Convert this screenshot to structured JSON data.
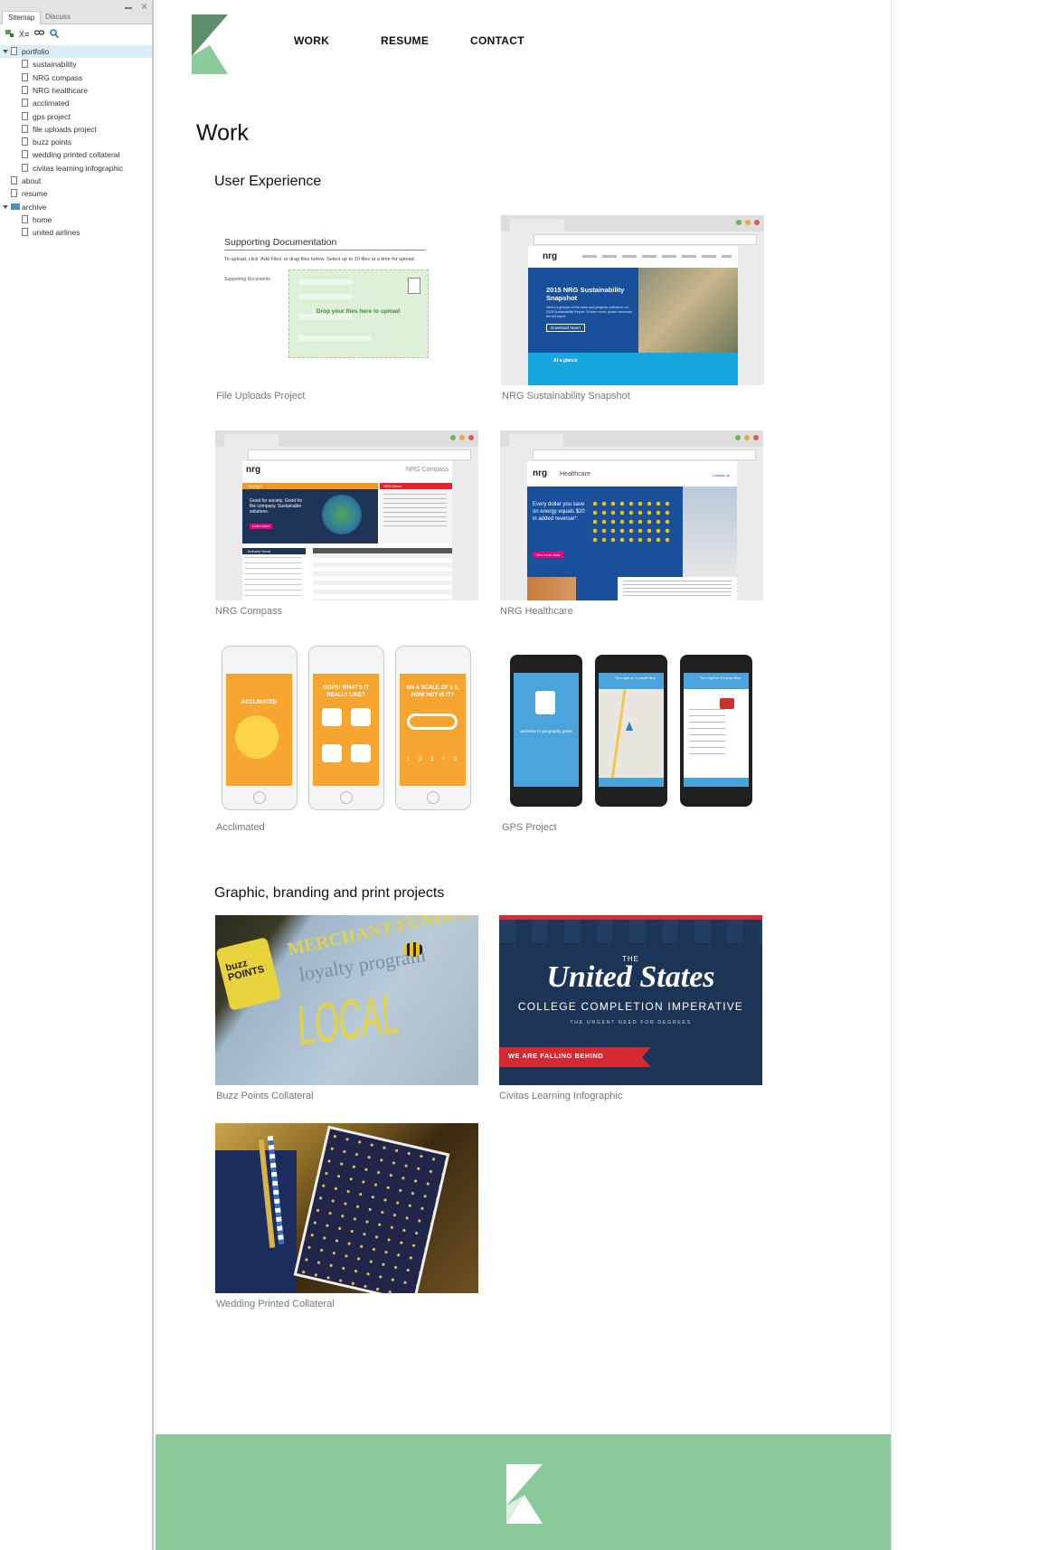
{
  "sidebar": {
    "tabs": [
      "Sitemap",
      "Discuss"
    ],
    "close_glyph": "×",
    "tree": [
      {
        "label": "portfolio",
        "level": 0,
        "type": "page",
        "expanded": true,
        "selected": true
      },
      {
        "label": "sustainability",
        "level": 1,
        "type": "page"
      },
      {
        "label": "NRG compass",
        "level": 1,
        "type": "page"
      },
      {
        "label": "NRG healthcare",
        "level": 1,
        "type": "page"
      },
      {
        "label": "acclimated",
        "level": 1,
        "type": "page"
      },
      {
        "label": "gps project",
        "level": 1,
        "type": "page"
      },
      {
        "label": "file uploads project",
        "level": 1,
        "type": "page"
      },
      {
        "label": "buzz points",
        "level": 1,
        "type": "page"
      },
      {
        "label": "wedding printed collateral",
        "level": 1,
        "type": "page"
      },
      {
        "label": "civitas learning infographic",
        "level": 1,
        "type": "page"
      },
      {
        "label": "about",
        "level": 0,
        "type": "page"
      },
      {
        "label": "resume",
        "level": 0,
        "type": "page"
      },
      {
        "label": "archive",
        "level": 0,
        "type": "folder",
        "expanded": true
      },
      {
        "label": "home",
        "level": 1,
        "type": "page"
      },
      {
        "label": "united airlines",
        "level": 1,
        "type": "page"
      }
    ]
  },
  "nav": {
    "work": "WORK",
    "resume": "RESUME",
    "contact": "CONTACT"
  },
  "page_title": "Work",
  "sections": {
    "ux": "User Experience",
    "graphic": "Graphic, branding and print projects"
  },
  "projects": {
    "file_uploads": {
      "caption": "File Uploads Project",
      "heading": "Supporting Documentation",
      "instructions": "To upload, click 'Add Files' or drag files below. Select up to 10 files at a time for upload.",
      "field_label": "Supporting Documents",
      "drop_text": "Drop your files here to upload"
    },
    "nrg_sustainability": {
      "caption": "NRG Sustainability Snapshot",
      "brand": "nrg",
      "hero_title": "2015 NRG Sustainability Snapshot",
      "hero_text": "Here's a glimpse of the news and progress outlined in our 2015 Sustainability Report. To learn more, please download the full report.",
      "hero_button": "Download report",
      "strip_title": "At a glance"
    },
    "nrg_compass": {
      "caption": "NRG Compass",
      "brand": "nrg",
      "site_name": "NRG Compass",
      "promo_label": "Spotlight",
      "promo_text": "Good for society. Good for the company. Sustainable solutions.",
      "promo_button": "Learn more",
      "news_label": "NRG News",
      "industry_label": "Industry News"
    },
    "nrg_healthcare": {
      "caption": "NRG Healthcare",
      "brand": "nrg",
      "site_name": "Healthcare",
      "hero_text": "Every dollar you save on energy equals $20 in added revenue*.",
      "hero_amount": "$20",
      "hero_button": "See more data",
      "contact": "Contact us"
    },
    "acclimated": {
      "caption": "Acclimated",
      "screens": [
        "ACCLIMATED",
        "OOPS! WHAT'S IT REALLY LIKE?",
        "ON A SCALE OF 1-5, HOW HOT IS IT?"
      ],
      "scale": [
        "1",
        "2",
        "3",
        "4",
        "5"
      ]
    },
    "gps": {
      "caption": "GPS Project",
      "welcome": "welcome to geography game",
      "turn_text": "Turn right on S Lamar Blvd"
    },
    "buzz_points": {
      "caption": "Buzz Points Collateral",
      "logo_text": "buzz POINTS",
      "wall_text_1": "MERCHANT-FUNDED",
      "wall_text_2": "loyalty program",
      "wall_text_3": "LOCAL"
    },
    "civitas": {
      "caption": "Civitas Learning Infographic",
      "the": "THE",
      "title": "United States",
      "subtitle": "COLLEGE COMPLETION IMPERATIVE",
      "tagline": "THE URGENT NEED FOR DEGREES",
      "banner": "WE ARE FALLING BEHIND"
    },
    "wedding": {
      "caption": "Wedding Printed Collateral"
    }
  },
  "colors": {
    "logo_dark": "#5c8f6a",
    "logo_light": "#8acb9b",
    "footer": "#8aca9a",
    "nrg_blue": "#1a4f9c",
    "nrg_cyan": "#16a6e0",
    "acclimated_orange": "#f7a531",
    "civitas_navy": "#1c3455",
    "civitas_red": "#d42a34",
    "buzz_blue": "#9fb6c9",
    "buzz_yellow": "#e8d33c"
  }
}
